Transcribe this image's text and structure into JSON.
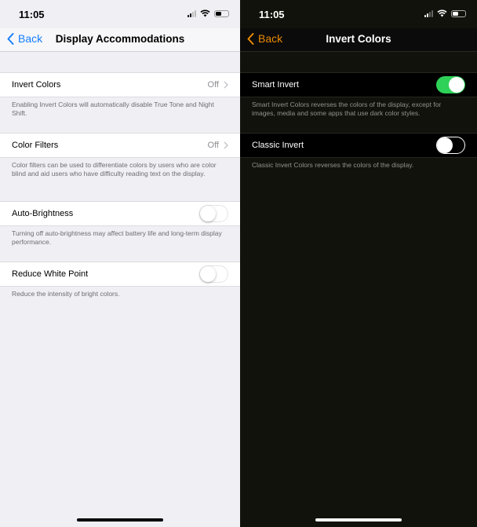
{
  "left_screen": {
    "status_bar": {
      "time": "11:05",
      "icons": [
        "cellular-signal-icon",
        "wifi-icon",
        "battery-icon"
      ]
    },
    "nav": {
      "back_label": "Back",
      "title": "Display Accommodations",
      "accent": "#157efb"
    },
    "rows": [
      {
        "label": "Invert Colors",
        "value": "Off",
        "type": "disclosure",
        "footnote": "Enabling Invert Colors will automatically disable True Tone and Night Shift."
      },
      {
        "label": "Color Filters",
        "value": "Off",
        "type": "disclosure",
        "footnote": "Color filters can be used to differentiate colors by users who are color blind and aid users who have difficulty reading text on the display."
      },
      {
        "label": "Auto-Brightness",
        "type": "toggle",
        "on": false,
        "footnote": "Turning off auto-brightness may affect battery life and long-term display performance."
      },
      {
        "label": "Reduce White Point",
        "type": "toggle",
        "on": false,
        "footnote": "Reduce the intensity of bright colors."
      }
    ]
  },
  "right_screen": {
    "status_bar": {
      "time": "11:05",
      "icons": [
        "cellular-signal-icon",
        "wifi-icon",
        "battery-icon"
      ]
    },
    "nav": {
      "back_label": "Back",
      "title": "Invert Colors",
      "accent": "#ea8a04"
    },
    "rows": [
      {
        "label": "Smart Invert",
        "type": "toggle",
        "on": true,
        "footnote": "Smart Invert Colors reverses the colors of the display, except for images, media and some apps that use dark color styles."
      },
      {
        "label": "Classic Invert",
        "type": "toggle",
        "on": false,
        "footnote": "Classic Invert Colors reverses the colors of the display."
      }
    ],
    "toggle_on_color": "#2ed158"
  }
}
